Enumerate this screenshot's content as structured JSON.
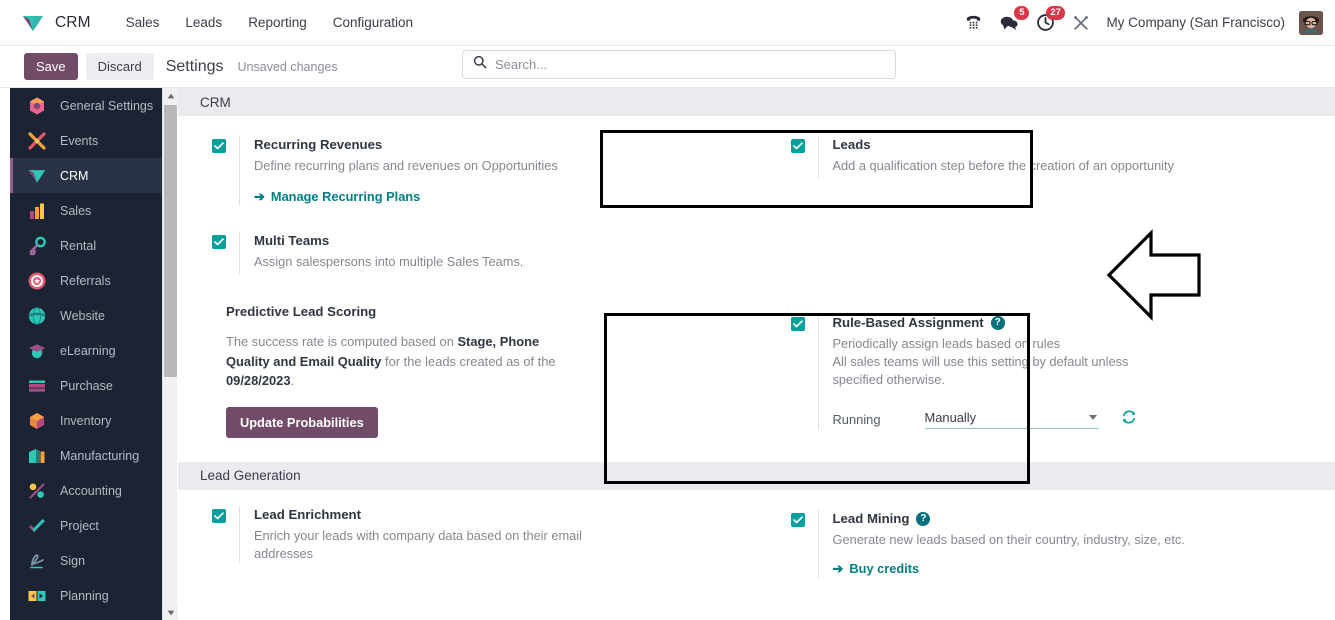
{
  "navbar": {
    "brand": "CRM",
    "logo_icon": "crm-diamond-logo",
    "links": [
      {
        "label": "Sales",
        "name": "nav-link-sales"
      },
      {
        "label": "Leads",
        "name": "nav-link-leads"
      },
      {
        "label": "Reporting",
        "name": "nav-link-reporting"
      },
      {
        "label": "Configuration",
        "name": "nav-link-configuration"
      }
    ],
    "sys_icons": [
      {
        "name": "voip-dialpad-icon",
        "badge": ""
      },
      {
        "name": "messages-icon",
        "badge": "5"
      },
      {
        "name": "activities-clock-icon",
        "badge": "27"
      },
      {
        "name": "debug-tools-icon",
        "badge": ""
      }
    ],
    "company": "My Company (San Francisco)",
    "avatar_icon": "user-avatar"
  },
  "control_panel": {
    "save_label": "Save",
    "discard_label": "Discard",
    "title": "Settings",
    "status": "Unsaved changes"
  },
  "search": {
    "placeholder": "Search...",
    "value": "",
    "icon": "search-icon"
  },
  "sidebar": {
    "items": [
      {
        "label": "General Settings",
        "icon": "general-settings-icon",
        "active": false
      },
      {
        "label": "Events",
        "icon": "events-icon",
        "active": false
      },
      {
        "label": "CRM",
        "icon": "crm-icon",
        "active": true
      },
      {
        "label": "Sales",
        "icon": "sales-icon",
        "active": false
      },
      {
        "label": "Rental",
        "icon": "rental-icon",
        "active": false
      },
      {
        "label": "Referrals",
        "icon": "referrals-icon",
        "active": false
      },
      {
        "label": "Website",
        "icon": "website-icon",
        "active": false
      },
      {
        "label": "eLearning",
        "icon": "elearning-icon",
        "active": false
      },
      {
        "label": "Purchase",
        "icon": "purchase-icon",
        "active": false
      },
      {
        "label": "Inventory",
        "icon": "inventory-icon",
        "active": false
      },
      {
        "label": "Manufacturing",
        "icon": "manufacturing-icon",
        "active": false
      },
      {
        "label": "Accounting",
        "icon": "accounting-icon",
        "active": false
      },
      {
        "label": "Project",
        "icon": "project-icon",
        "active": false
      },
      {
        "label": "Sign",
        "icon": "sign-icon",
        "active": false
      },
      {
        "label": "Planning",
        "icon": "planning-icon",
        "active": false
      }
    ]
  },
  "sections": {
    "crm": {
      "band_title": "CRM",
      "recurring_revenues": {
        "title": "Recurring Revenues",
        "desc": "Define recurring plans and revenues on Opportunities",
        "link": "Manage Recurring Plans",
        "checked": true
      },
      "leads": {
        "title": "Leads",
        "desc": "Add a qualification step before the creation of an opportunity",
        "checked": true
      },
      "multi_teams": {
        "title": "Multi Teams",
        "desc": "Assign salespersons into multiple Sales Teams.",
        "checked": true
      },
      "predictive_lead_scoring": {
        "title": "Predictive Lead Scoring",
        "text_1": "The success rate is computed based on ",
        "bold_1": "Stage, Phone Quality and Email Quality",
        "text_2": " for the leads created as of the ",
        "bold_2": "09/28/2023",
        "text_3": ".",
        "button": "Update Probabilities"
      },
      "rule_based_assignment": {
        "title": "Rule-Based Assignment",
        "help_icon": "help-icon",
        "desc_line1": "Periodically assign leads based on rules",
        "desc_line2": "All sales teams will use this setting by default unless specified otherwise.",
        "running_label": "Running",
        "running_value": "Manually",
        "running_options": [
          "Manually"
        ],
        "refresh_icon": "refresh-icon",
        "checked": true
      }
    },
    "lead_generation": {
      "band_title": "Lead Generation",
      "lead_enrichment": {
        "title": "Lead Enrichment",
        "desc": "Enrich your leads with company data based on their email addresses",
        "checked": true
      },
      "lead_mining": {
        "title": "Lead Mining",
        "help_icon": "help-icon",
        "desc": "Generate new leads based on their country, industry, size, etc.",
        "link": "Buy credits",
        "checked": true
      }
    }
  },
  "annotations": {
    "highlight_boxes": [
      {
        "name": "leads-highlight-box"
      },
      {
        "name": "rule-based-assignment-highlight-box"
      }
    ],
    "arrow": {
      "name": "left-pointing-arrow-annotation",
      "direction": "left"
    }
  },
  "colors": {
    "brand_purple": "#714B67",
    "teal_accent": "#00A09D",
    "link_teal": "#017e84",
    "sidebar_bg": "#1c2433",
    "badge_red": "#dc3545",
    "band_gray": "#e9ebee"
  }
}
